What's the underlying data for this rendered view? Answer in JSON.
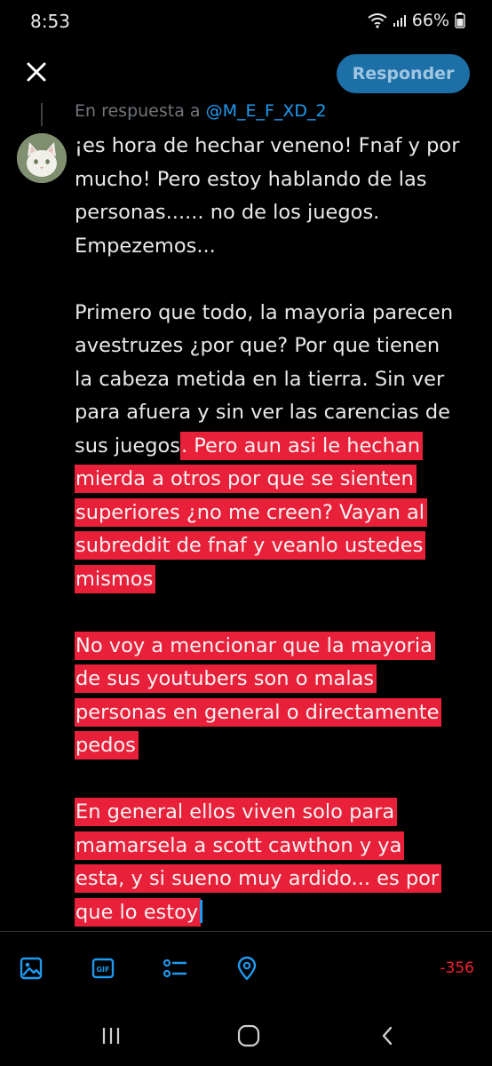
{
  "status_bar": {
    "time": "8:53",
    "battery": "66%"
  },
  "header": {
    "reply_button_label": "Responder"
  },
  "reply_context": {
    "prefix": "En respuesta a ",
    "handle": "@M_E_F_XD_2"
  },
  "tweet": {
    "lines": [
      "¡es hora de hechar veneno! Fnaf y por",
      "mucho! Pero estoy hablando de las",
      "personas...... no de los juegos.",
      "Empezemos...",
      "",
      "Primero que todo, la mayoria parecen",
      "avestruzes ¿por que? Por que tienen",
      "la cabeza metida en la tierra. Sin ver",
      "para afuera y sin ver las carencias de",
      "sus juegos",
      ". Pero aun asi le hechan",
      "mierda a otros por que se sienten",
      "superiores ¿no me creen? Vayan al",
      "subreddit de fnaf y veanlo ustedes",
      "mismos",
      "No voy a mencionar que la mayoria",
      "de sus youtubers son o malas",
      "personas en general o directamente",
      "pedos",
      "En general ellos viven solo para",
      "mamarsela a scott cawthon y ya",
      "esta, y si sueno muy ardido... es por",
      "que lo estoy"
    ]
  },
  "composer": {
    "char_count": "-356"
  },
  "colors": {
    "highlight": "#e8203a",
    "accent": "#1d9bf0",
    "reply_button": "#1d6fa8",
    "error": "#f4212e"
  },
  "icons": {
    "close": "close-icon",
    "image": "image-icon",
    "gif": "gif-icon",
    "poll": "poll-icon",
    "location": "location-icon"
  }
}
